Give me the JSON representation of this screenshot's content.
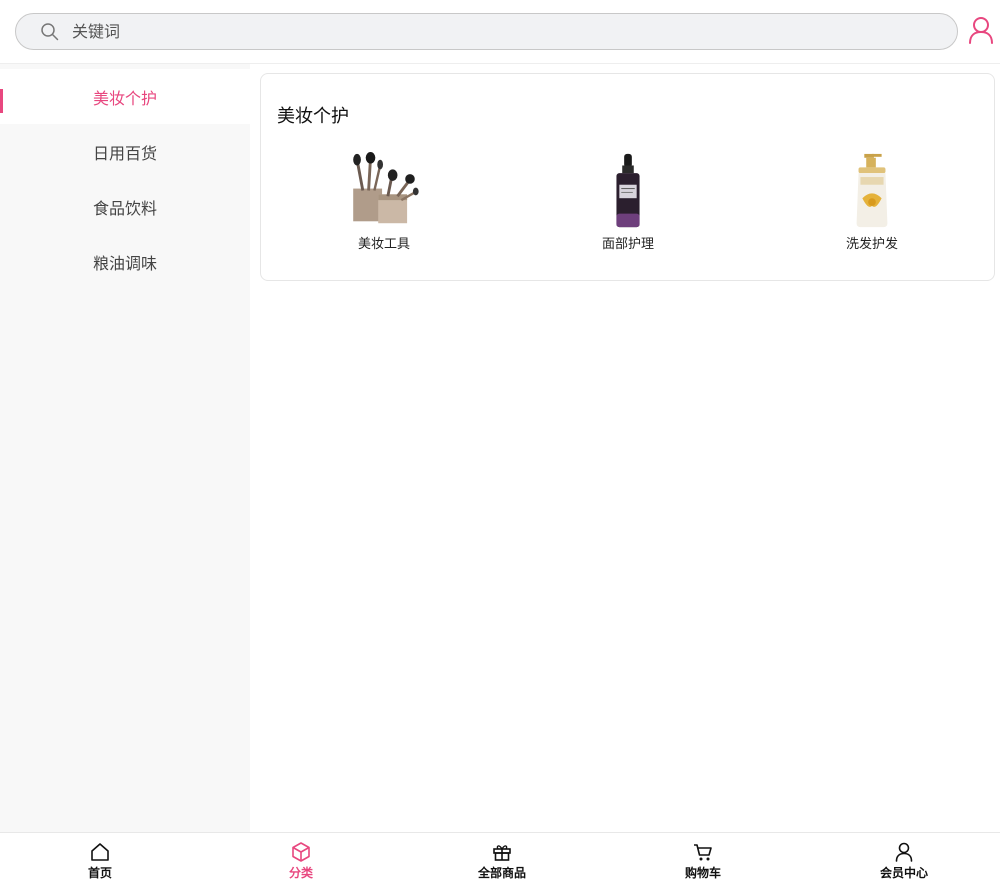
{
  "search": {
    "placeholder": "关键词"
  },
  "header": {
    "user_icon": "user-icon",
    "accent": "#e8477f"
  },
  "sidebar": {
    "items": [
      {
        "label": "美妆个护",
        "active": true
      },
      {
        "label": "日用百货",
        "active": false
      },
      {
        "label": "食品饮料",
        "active": false
      },
      {
        "label": "粮油调味",
        "active": false
      }
    ]
  },
  "content": {
    "title": "美妆个护",
    "subcategories": [
      {
        "label": "美妆工具",
        "icon": "makeup-brushes-image"
      },
      {
        "label": "面部护理",
        "icon": "serum-bottle-image"
      },
      {
        "label": "洗发护发",
        "icon": "shampoo-bottle-image"
      }
    ]
  },
  "tabbar": {
    "tabs": [
      {
        "label": "首页",
        "icon": "home-icon",
        "active": false
      },
      {
        "label": "分类",
        "icon": "cube-icon",
        "active": true
      },
      {
        "label": "全部商品",
        "icon": "gift-icon",
        "active": false
      },
      {
        "label": "购物车",
        "icon": "cart-icon",
        "active": false
      },
      {
        "label": "会员中心",
        "icon": "user-icon",
        "active": false
      }
    ]
  }
}
